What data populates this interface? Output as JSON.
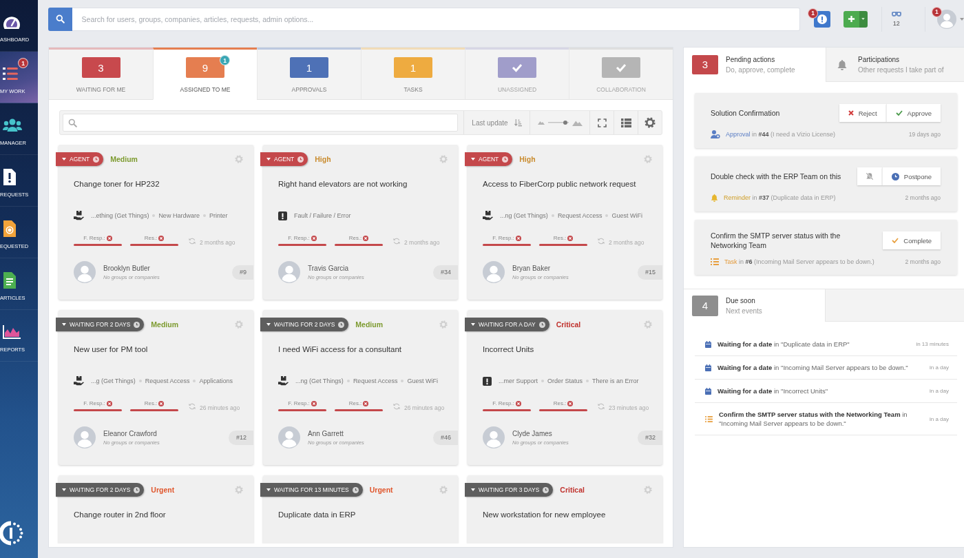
{
  "sidebar": {
    "items": [
      {
        "label": "ASHBOARD",
        "selected": false
      },
      {
        "label": "MY WORK",
        "selected": true,
        "badge": "1"
      },
      {
        "label": "MANAGER",
        "selected": false
      },
      {
        "label": "REQUESTS",
        "selected": false
      },
      {
        "label": "EQUESTED",
        "selected": false
      },
      {
        "label": "ARTICLES",
        "selected": false
      },
      {
        "label": "REPORTS",
        "selected": false
      }
    ]
  },
  "top_bar": {
    "search": {
      "placeholder": "Search for users, groups, companies, articles, requests, admin options..."
    },
    "alerts_badge": "1",
    "sessions_count": "12",
    "profile_badge": "1"
  },
  "work_tabs": [
    {
      "count": "3",
      "label": "WAITING FOR ME",
      "color": "#c8494d",
      "selected": false
    },
    {
      "count": "9",
      "label": "ASSIGNED TO ME",
      "color": "#e57e50",
      "selected": true,
      "badge": "1"
    },
    {
      "count": "1",
      "label": "APPROVALS",
      "color": "#4e71b6",
      "selected": false
    },
    {
      "count": "1",
      "label": "TASKS",
      "color": "#eeab40",
      "selected": false
    },
    {
      "label": "UNASSIGNED",
      "color": "#a09dca",
      "selected": false
    },
    {
      "label": "COLLABORATION",
      "color": "#b5b5b5",
      "selected": false
    }
  ],
  "toolbar": {
    "sort_label": "Last update",
    "zoom": {
      "level": 0.85
    }
  },
  "cards": [
    {
      "tag": {
        "kind": "agent",
        "label": "AGENT"
      },
      "priority": {
        "label": "Medium",
        "color": "#7c9a2e"
      },
      "title": "Change toner for HP232",
      "category": {
        "kind": "service",
        "path": [
          "...ething (Get Things)",
          "New Hardware",
          "Printer"
        ]
      },
      "sla": [
        {
          "label": "F. Resp.:",
          "breached": true
        },
        {
          "label": "Res.:",
          "breached": true
        }
      ],
      "updated": "2 months ago",
      "requester": {
        "name": "Brooklyn Butler",
        "org": "No groups or companies"
      },
      "id": "#9"
    },
    {
      "tag": {
        "kind": "agent",
        "label": "AGENT"
      },
      "priority": {
        "label": "High",
        "color": "#c98b2d"
      },
      "title": "Right hand elevators are not working",
      "category": {
        "kind": "incident",
        "path": [
          "Fault / Failure / Error"
        ]
      },
      "sla": [
        {
          "label": "F. Resp.:",
          "breached": true
        },
        {
          "label": "Res.:",
          "breached": true
        }
      ],
      "updated": "2 months ago",
      "requester": {
        "name": "Travis Garcia",
        "org": "No groups or companies"
      },
      "id": "#34"
    },
    {
      "tag": {
        "kind": "agent",
        "label": "AGENT"
      },
      "priority": {
        "label": "High",
        "color": "#c98b2d"
      },
      "title": "Access to FiberCorp public network request",
      "category": {
        "kind": "service",
        "path": [
          "...ng (Get Things)",
          "Request Access",
          "Guest WiFi"
        ]
      },
      "sla": [
        {
          "label": "F. Resp.:",
          "breached": true
        },
        {
          "label": "Res.:",
          "breached": true
        }
      ],
      "updated": "2 months ago",
      "requester": {
        "name": "Bryan Baker",
        "org": "No groups or companies"
      },
      "id": "#15"
    },
    {
      "tag": {
        "kind": "waiting",
        "label": "WAITING FOR 2 DAYS"
      },
      "priority": {
        "label": "Medium",
        "color": "#7c9a2e"
      },
      "title": "New user for PM tool",
      "category": {
        "kind": "service",
        "path": [
          "...g (Get Things)",
          "Request Access",
          "Applications"
        ]
      },
      "sla": [
        {
          "label": "F. Resp.:",
          "breached": true
        },
        {
          "label": "Res.:",
          "breached": true
        }
      ],
      "updated": "26 minutes ago",
      "requester": {
        "name": "Eleanor Crawford",
        "org": "No groups or companies"
      },
      "id": "#12"
    },
    {
      "tag": {
        "kind": "waiting",
        "label": "WAITING FOR 2 DAYS"
      },
      "priority": {
        "label": "Medium",
        "color": "#7c9a2e"
      },
      "title": "I need WiFi access for a consultant",
      "category": {
        "kind": "service",
        "path": [
          "...ng (Get Things)",
          "Request Access",
          "Guest WiFi"
        ]
      },
      "sla": [
        {
          "label": "F. Resp.:",
          "breached": true
        },
        {
          "label": "Res.:",
          "breached": true
        }
      ],
      "updated": "26 minutes ago",
      "requester": {
        "name": "Ann Garrett",
        "org": "No groups or companies"
      },
      "id": "#46"
    },
    {
      "tag": {
        "kind": "waiting",
        "label": "WAITING FOR A DAY"
      },
      "priority": {
        "label": "Critical",
        "color": "#c0312c"
      },
      "title": "Incorrect Units",
      "category": {
        "kind": "incident",
        "path": [
          "...mer Support",
          "Order Status",
          "There is an Error"
        ]
      },
      "sla": [
        {
          "label": "F. Resp.:",
          "breached": true
        },
        {
          "label": "Res.:",
          "breached": true
        }
      ],
      "updated": "23 minutes ago",
      "requester": {
        "name": "Clyde James",
        "org": "No groups or companies"
      },
      "id": "#32"
    },
    {
      "tag": {
        "kind": "waiting",
        "label": "WAITING FOR 2 DAYS"
      },
      "priority": {
        "label": "Urgent",
        "color": "#e0562c"
      },
      "title": "Change router in 2nd floor"
    },
    {
      "tag": {
        "kind": "waiting",
        "label": "WAITING FOR 13 MINUTES"
      },
      "priority": {
        "label": "Urgent",
        "color": "#e0562c"
      },
      "title": "Duplicate data in ERP"
    },
    {
      "tag": {
        "kind": "waiting",
        "label": "WAITING FOR 3 DAYS"
      },
      "priority": {
        "label": "Critical",
        "color": "#c0312c"
      },
      "title": "New workstation for new employee"
    }
  ],
  "pending": {
    "tabs": [
      {
        "count": "3",
        "title": "Pending actions",
        "subtitle": "Do, approve, complete",
        "selected": true
      },
      {
        "title": "Participations",
        "subtitle": "Other requests I take part of",
        "selected": false
      }
    ],
    "actions": [
      {
        "kind": "approval",
        "title": "Solution Confirmation",
        "buttons": [
          {
            "kind": "reject",
            "label": "Reject"
          },
          {
            "kind": "approve",
            "label": "Approve"
          }
        ],
        "type_label": "Approval",
        "detail": "in **#44** (I need a Vizio License)",
        "time": "19 days ago"
      },
      {
        "kind": "reminder",
        "title": "Double check with the ERP Team on this",
        "buttons": [
          {
            "kind": "mute"
          },
          {
            "kind": "postpone",
            "label": "Postpone"
          }
        ],
        "type_label": "Reminder",
        "detail": "in **#37** (Duplicate data in ERP)",
        "time": "2 months ago"
      },
      {
        "kind": "task",
        "title": "Confirm the SMTP server status with the Networking Team",
        "buttons": [
          {
            "kind": "complete",
            "label": "Complete"
          }
        ],
        "type_label": "Task",
        "detail": "in **#6** (Incoming Mail Server appears to be down.)",
        "time": "2 months ago"
      }
    ]
  },
  "due_soon": {
    "count": "4",
    "title": "Due soon",
    "subtitle": "Next events",
    "items": [
      {
        "kind": "date",
        "text": "**Waiting for a date** in \"Duplicate data in ERP\"",
        "time": "in 13 minutes"
      },
      {
        "kind": "date",
        "text": "**Waiting for a date** in \"Incoming Mail Server appears to be down.\"",
        "time": "in a day"
      },
      {
        "kind": "date",
        "text": "**Waiting for a date** in \"Incorrect Units\"",
        "time": "in a day"
      },
      {
        "kind": "task",
        "text": "**Confirm the SMTP server status with the Networking Team** in \"Incoming Mail Server appears to be down.\"",
        "time": "in a day"
      }
    ]
  }
}
